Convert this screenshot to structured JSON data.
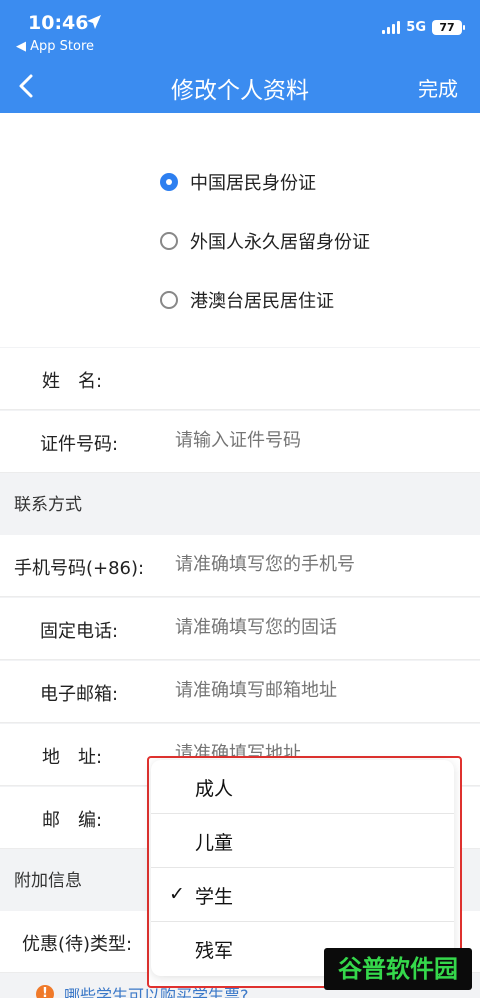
{
  "status_bar": {
    "time": "10:46",
    "back_app": "◀ App Store",
    "network": "5G",
    "battery": "77"
  },
  "nav": {
    "title": "修改个人资料",
    "done": "完成"
  },
  "id_types": [
    {
      "label": "中国居民身份证",
      "checked": true
    },
    {
      "label": "外国人永久居留身份证",
      "checked": false
    },
    {
      "label": "港澳台居民居住证",
      "checked": false
    }
  ],
  "identity": {
    "name_label": "姓　名:",
    "id_label": "证件号码:",
    "id_placeholder": "请输入证件号码"
  },
  "contact": {
    "header": "联系方式",
    "mobile_label": "手机号码(+86):",
    "mobile_placeholder": "请准确填写您的手机号",
    "landline_label": "固定电话:",
    "landline_placeholder": "请准确填写您的固话",
    "email_label": "电子邮箱:",
    "email_placeholder": "请准确填写邮箱地址",
    "address_label": "地　址:",
    "address_placeholder": "请准确填写地址",
    "postcode_label": "邮　编:"
  },
  "extra": {
    "header": "附加信息",
    "discount_label": "优惠(待)类型:"
  },
  "notice": {
    "text": "哪些学生可以购买学生票?"
  },
  "dropdown": {
    "options": [
      {
        "label": "成人",
        "checked": false
      },
      {
        "label": "儿童",
        "checked": false
      },
      {
        "label": "学生",
        "checked": true
      },
      {
        "label": "残军",
        "checked": false
      }
    ],
    "check_mark": "✓"
  },
  "watermark": "谷普软件园",
  "colors": {
    "accent": "#3b8cf0",
    "highlight_border": "#e0322f",
    "watermark_green": "#35d84b"
  }
}
